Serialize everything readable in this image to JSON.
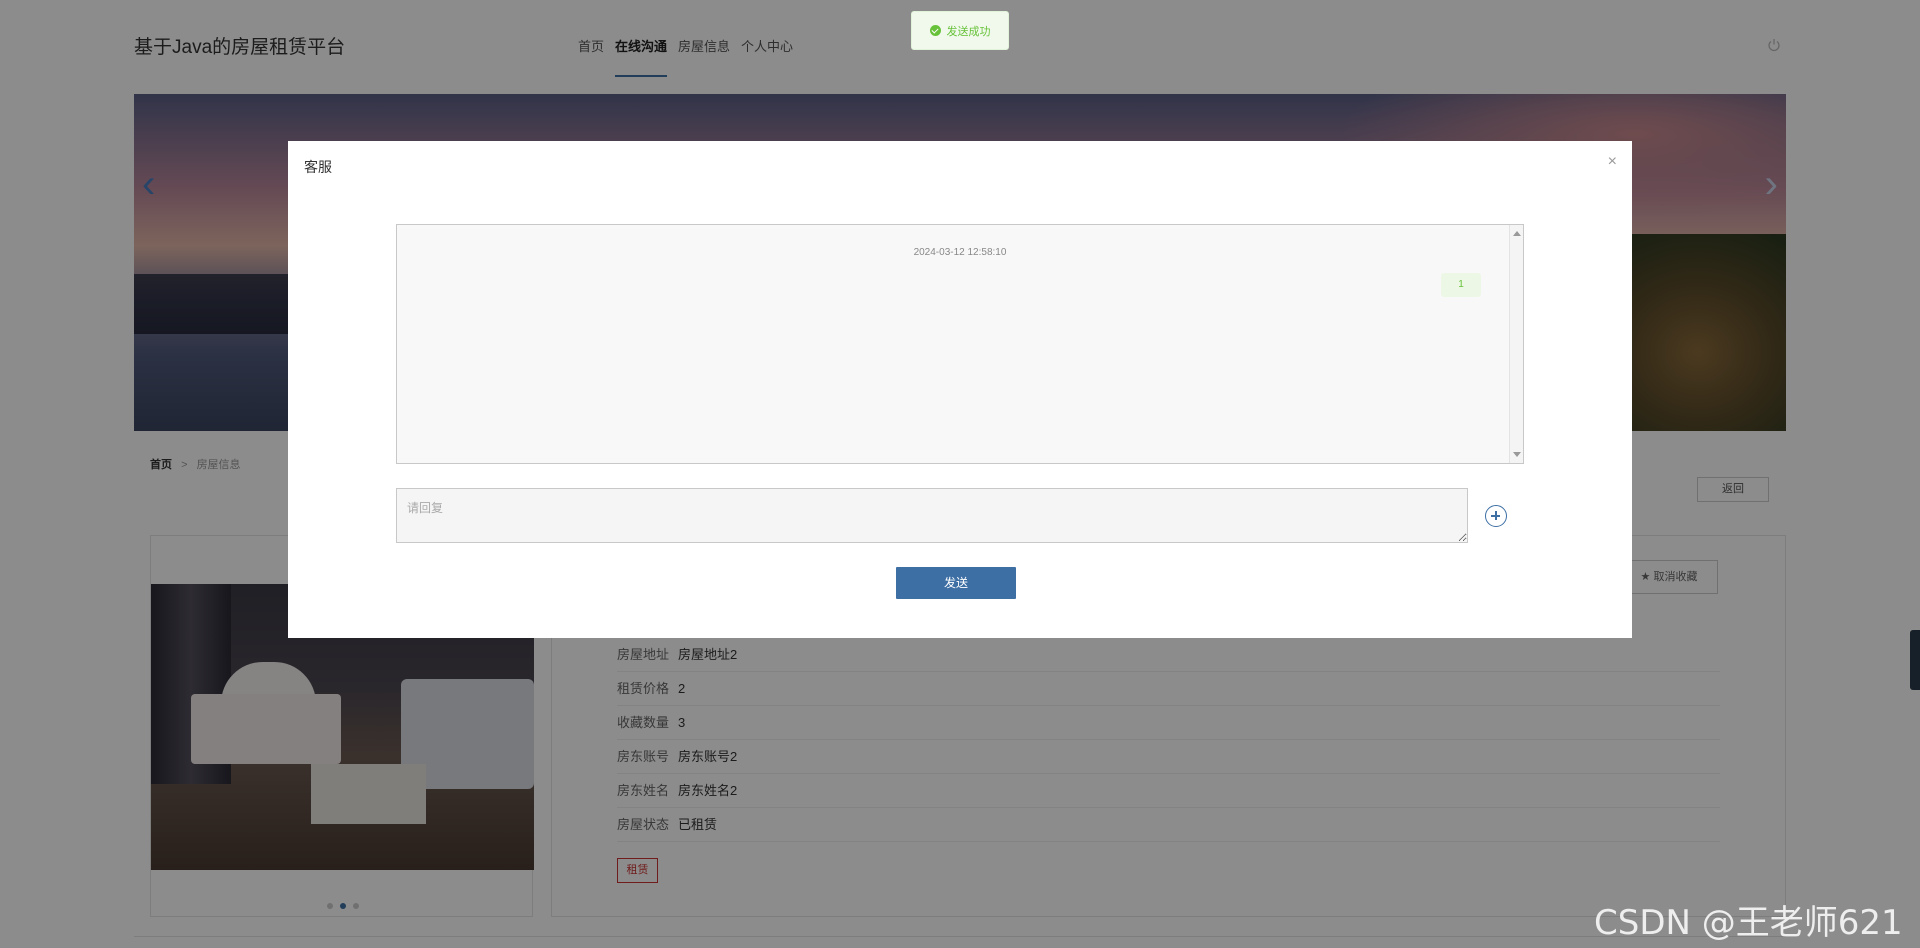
{
  "site": {
    "title": "基于Java的房屋租赁平台",
    "nav": [
      "首页",
      "在线沟通",
      "房屋信息",
      "个人中心"
    ],
    "active_nav": "在线沟通",
    "logout_icon": "power-icon"
  },
  "banner": {
    "prev_icon": "chevron-left-icon",
    "next_icon": "chevron-right-icon"
  },
  "breadcrumb": {
    "home": "首页",
    "separator": ">",
    "current": "房屋信息"
  },
  "back_label": "返回",
  "favorite_label": "取消收藏",
  "details": [
    {
      "label": "房屋地址",
      "value": "房屋地址2"
    },
    {
      "label": "租赁价格",
      "value": "2"
    },
    {
      "label": "收藏数量",
      "value": "3"
    },
    {
      "label": "房东账号",
      "value": "房东账号2"
    },
    {
      "label": "房东姓名",
      "value": "房东姓名2"
    },
    {
      "label": "房屋状态",
      "value": "已租赁"
    }
  ],
  "rent_label": "租赁",
  "carousel_active_index": 1,
  "toast": {
    "message": "发送成功",
    "type": "success",
    "color": "#67c23a"
  },
  "dialog": {
    "title": "客服",
    "close": "×",
    "messages": [
      {
        "time": "2024-03-12 12:58:10",
        "text": "1",
        "side": "right"
      }
    ],
    "reply_placeholder": "请回复",
    "reply_value": "",
    "send_label": "发送"
  },
  "watermark": "CSDN @王老师621",
  "colors": {
    "primary": "#3d6fa4",
    "danger": "#cc3333",
    "success": "#67c23a"
  }
}
